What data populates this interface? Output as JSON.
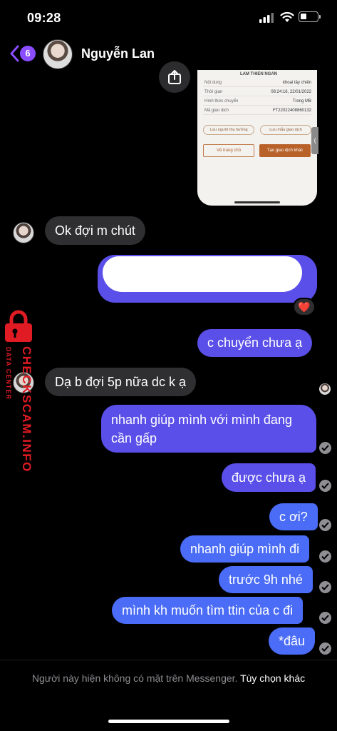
{
  "status_bar": {
    "time": "09:28",
    "icons": [
      "signal-icon",
      "wifi-icon",
      "battery-icon"
    ]
  },
  "header": {
    "back_icon": "chevron-left-icon",
    "unread_count": "6",
    "contact_name": "Nguyễn Lan"
  },
  "shared_receipt": {
    "recipient_name": "LAM THIEN NGAN",
    "rows": [
      {
        "key": "Nội dung",
        "value": "khoai tây chiên"
      },
      {
        "key": "Thời gian",
        "value": "08:24:16, 22/01/2022"
      },
      {
        "key": "Hình thức chuyển",
        "value": "Trong MB"
      },
      {
        "key": "Mã giao dịch",
        "value": "FT22022408860132"
      }
    ],
    "save_recipient": "Lưu người thụ hưởng",
    "save_template": "Lưu mẫu giao dịch",
    "home_button": "Về trang chủ",
    "new_transaction_button": "Tạo giao dịch khác",
    "side_tab": "⟨"
  },
  "messages": [
    {
      "direction": "incoming",
      "text": "Ok đợi m chút"
    },
    {
      "direction": "outgoing",
      "text": "",
      "redacted": true,
      "reaction": "❤️"
    },
    {
      "direction": "outgoing",
      "text": "c chuyển chưa ạ"
    },
    {
      "direction": "incoming",
      "text": "Dạ b đợi 5p nữa dc k ạ"
    },
    {
      "direction": "outgoing",
      "text": "nhanh giúp mình với mình đang cần gấp"
    },
    {
      "direction": "outgoing",
      "text": "được chưa ạ"
    },
    {
      "direction": "outgoing",
      "text": "c ơi?"
    },
    {
      "direction": "outgoing",
      "text": "nhanh giúp mình đi"
    },
    {
      "direction": "outgoing",
      "text": "trước 9h nhé"
    },
    {
      "direction": "outgoing",
      "text": "mình kh muốn tìm ttin của c đi"
    },
    {
      "direction": "outgoing",
      "text": "*đâu"
    }
  ],
  "watermark": {
    "brand": "CHECKSCAM.INFO",
    "tag": "DATA CENTER"
  },
  "footer": {
    "note": "Người này hiện không có mặt trên Messenger.",
    "option": "Tùy chọn khác"
  },
  "colors": {
    "bubble_in": "#2f2f31",
    "bubble_out_purple": "#5a4fe8",
    "bubble_out_blue": "#4a6cf6",
    "unread_badge": "#8a4dff",
    "watermark": "#e01b24"
  }
}
